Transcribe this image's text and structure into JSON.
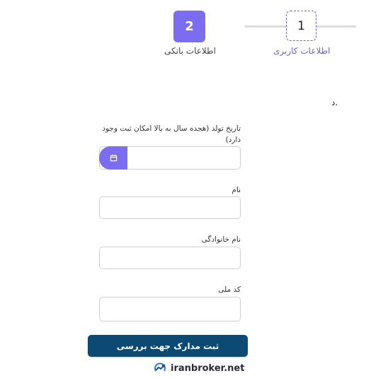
{
  "stepper": {
    "steps": [
      {
        "number": "1",
        "label": "اطلاعات کاربری"
      },
      {
        "number": "2",
        "label": "اطلاعات بانکی"
      }
    ],
    "colors": {
      "accent": "#7b6cf0",
      "line": "#dcdcdc",
      "active_label": "#6b64d8"
    }
  },
  "intro_text": ".د",
  "form": {
    "birth_date": {
      "label": "تاریخ تولد (هجده سال به بالا امکان ثبت وجود دارد)",
      "value": "",
      "icon": "calendar-icon"
    },
    "first_name": {
      "label": "نام",
      "value": ""
    },
    "last_name": {
      "label": "نام خانوادگی",
      "value": ""
    },
    "national_code": {
      "label": "کد ملی",
      "value": ""
    },
    "submit_label": "ثبت مدارک جهت بررسی",
    "submit_color": "#0d4a73"
  },
  "watermark": {
    "text": "iranbroker.net",
    "icon": "trend-chart-icon"
  }
}
